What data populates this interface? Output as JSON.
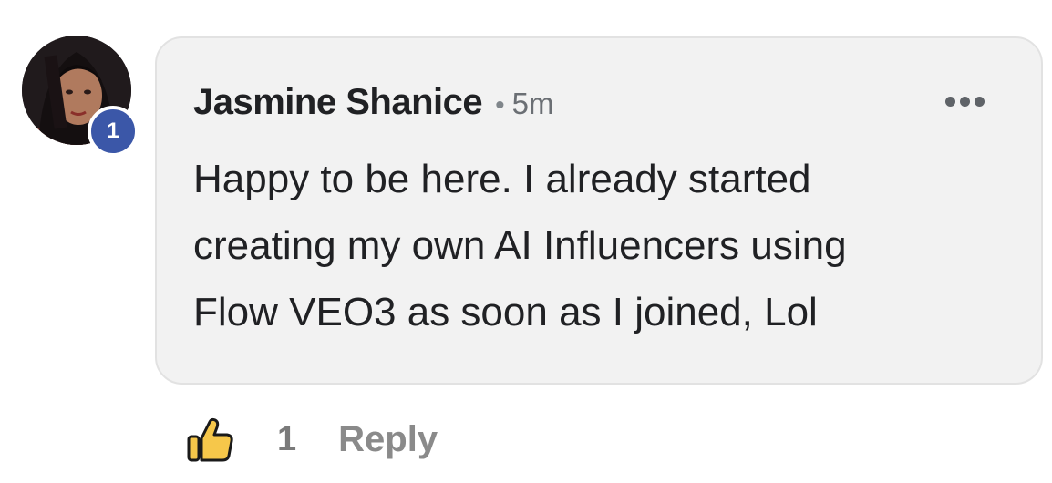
{
  "comment": {
    "author": "Jasmine Shanice",
    "separator": "•",
    "time": "5m",
    "level_badge": "1",
    "body_lines": [
      "Happy to be here. I already started",
      "creating my own AI Influencers using",
      "Flow VEO3 as soon as I joined, Lol"
    ],
    "more_icon": "more-horizontal-icon",
    "bubble_color": "#f2f2f2",
    "badge_color": "#3b57a8"
  },
  "actions": {
    "like_icon": "thumbs-up-icon",
    "like_count": "1",
    "reply_label": "Reply",
    "like_icon_color": "#f6c74a"
  }
}
